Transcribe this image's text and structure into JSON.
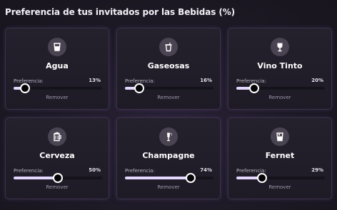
{
  "title": "Preferencia de tus invitados por las Bebidas (%)",
  "pref_label": "Preferencia:",
  "remove_label": "Remover",
  "drinks": [
    {
      "name": "Agua",
      "pct_text": "13%",
      "value": 13,
      "icon": "glass-water-icon"
    },
    {
      "name": "Gaseosas",
      "pct_text": "16%",
      "value": 16,
      "icon": "soda-cup-icon"
    },
    {
      "name": "Vino Tinto",
      "pct_text": "20%",
      "value": 20,
      "icon": "wine-glass-icon"
    },
    {
      "name": "Cerveza",
      "pct_text": "50%",
      "value": 50,
      "icon": "beer-mug-icon"
    },
    {
      "name": "Champagne",
      "pct_text": "74%",
      "value": 74,
      "icon": "champagne-glass-icon"
    },
    {
      "name": "Fernet",
      "pct_text": "29%",
      "value": 29,
      "icon": "fernet-glass-icon"
    }
  ],
  "colors": {
    "accent_fill": "#e4d8ff",
    "card_border": "#3a3147",
    "icon_bg": "#4a4452"
  }
}
